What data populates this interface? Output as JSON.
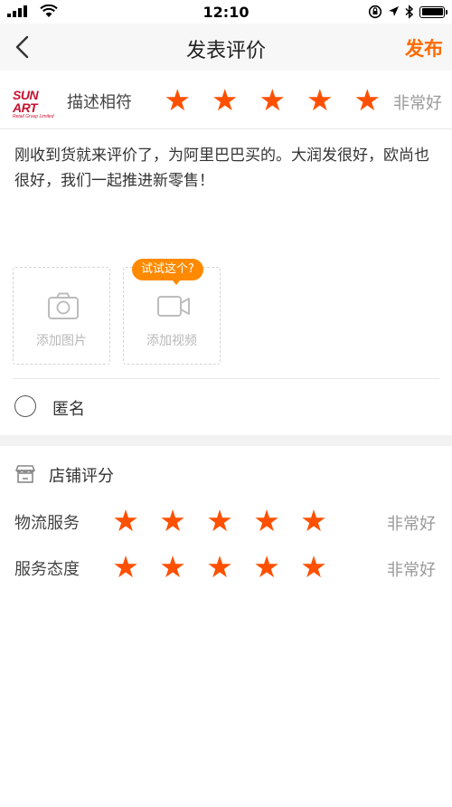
{
  "status_bar": {
    "time": "12:10"
  },
  "nav": {
    "title": "发表评价",
    "publish_label": "发布"
  },
  "product_rating": {
    "logo_main": "SUN ART",
    "logo_sub": "Retail Group Limited",
    "label": "描述相符",
    "stars": 5,
    "max_stars": 5,
    "verdict": "非常好"
  },
  "review": {
    "text": "刚收到货就来评价了，为阿里巴巴买的。大润发很好，欧尚也很好，我们一起推进新零售！"
  },
  "uploads": {
    "photo_label": "添加图片",
    "video_label": "添加视频",
    "tip": "试试这个?"
  },
  "anonymous": {
    "label": "匿名",
    "checked": false
  },
  "shop_rating": {
    "title": "店铺评分",
    "rows": [
      {
        "label": "物流服务",
        "stars": 5,
        "verdict": "非常好"
      },
      {
        "label": "服务态度",
        "stars": 5,
        "verdict": "非常好"
      }
    ]
  },
  "colors": {
    "accent": "#ff6a00",
    "star": "#ff5000",
    "tip": "#ff8a00",
    "brand_red": "#c8102e"
  }
}
